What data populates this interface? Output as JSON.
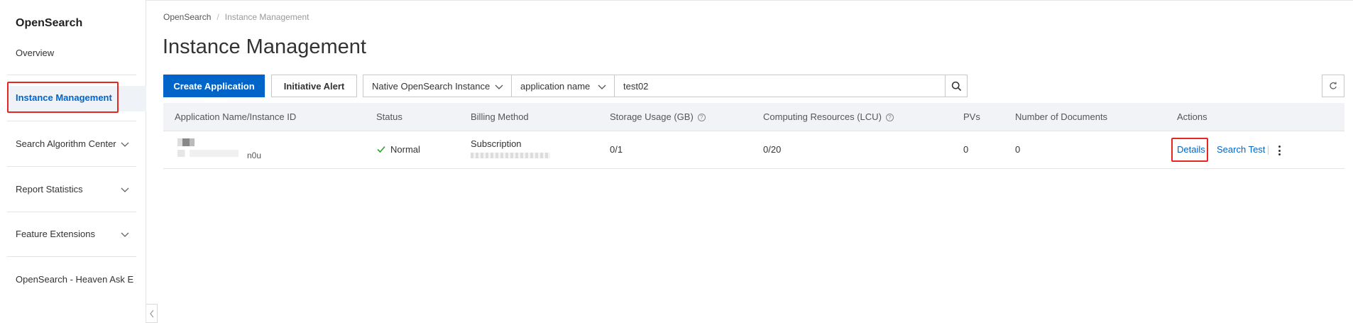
{
  "sidebar": {
    "title": "OpenSearch",
    "overview": "Overview",
    "active_item": "Instance Management",
    "groups": [
      {
        "label": "Search Algorithm Center"
      },
      {
        "label": "Report Statistics"
      },
      {
        "label": "Feature Extensions"
      }
    ],
    "footer_item": "OpenSearch - Heaven Ask E"
  },
  "breadcrumb": {
    "root": "OpenSearch",
    "separator": "/",
    "current": "Instance Management"
  },
  "page_title": "Instance Management",
  "toolbar": {
    "create_label": "Create Application",
    "alert_label": "Initiative Alert",
    "instance_type": "Native OpenSearch Instance",
    "search_field": "application name",
    "search_value": "test02"
  },
  "table": {
    "headers": {
      "name": "Application Name/Instance ID",
      "status": "Status",
      "billing": "Billing Method",
      "storage": "Storage Usage (GB)",
      "compute": "Computing Resources (LCU)",
      "pvs": "PVs",
      "docs": "Number of Documents",
      "actions": "Actions"
    },
    "rows": [
      {
        "id_suffix": "n0u",
        "status": "Normal",
        "billing": "Subscription",
        "storage": "0/1",
        "compute": "0/20",
        "pvs": "0",
        "docs": "0",
        "action_details": "Details",
        "action_search_test": "Search Test"
      }
    ]
  },
  "colors": {
    "primary": "#0064c8",
    "highlight_frame": "#e5271f",
    "brand_accent": "#ff6a00",
    "success": "#2ca02c"
  }
}
